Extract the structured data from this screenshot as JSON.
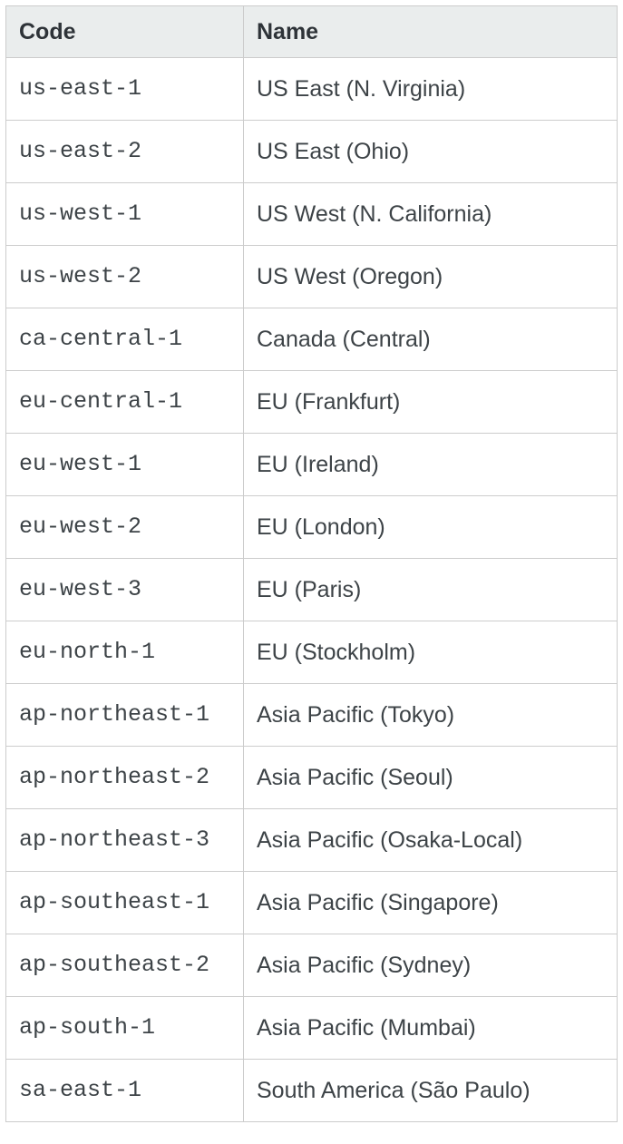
{
  "table": {
    "headers": {
      "code": "Code",
      "name": "Name"
    },
    "rows": [
      {
        "code": "us-east-1",
        "name": "US East (N. Virginia)"
      },
      {
        "code": "us-east-2",
        "name": "US East (Ohio)"
      },
      {
        "code": "us-west-1",
        "name": "US West (N. California)"
      },
      {
        "code": "us-west-2",
        "name": "US West (Oregon)"
      },
      {
        "code": "ca-central-1",
        "name": "Canada (Central)"
      },
      {
        "code": "eu-central-1",
        "name": "EU (Frankfurt)"
      },
      {
        "code": "eu-west-1",
        "name": "EU (Ireland)"
      },
      {
        "code": "eu-west-2",
        "name": "EU (London)"
      },
      {
        "code": "eu-west-3",
        "name": "EU (Paris)"
      },
      {
        "code": "eu-north-1",
        "name": "EU (Stockholm)"
      },
      {
        "code": "ap-northeast-1",
        "name": "Asia Pacific (Tokyo)"
      },
      {
        "code": "ap-northeast-2",
        "name": "Asia Pacific (Seoul)"
      },
      {
        "code": "ap-northeast-3",
        "name": "Asia Pacific (Osaka-Local)"
      },
      {
        "code": "ap-southeast-1",
        "name": "Asia Pacific (Singapore)"
      },
      {
        "code": "ap-southeast-2",
        "name": "Asia Pacific (Sydney)"
      },
      {
        "code": "ap-south-1",
        "name": "Asia Pacific (Mumbai)"
      },
      {
        "code": "sa-east-1",
        "name": "South America (São Paulo)"
      }
    ]
  }
}
